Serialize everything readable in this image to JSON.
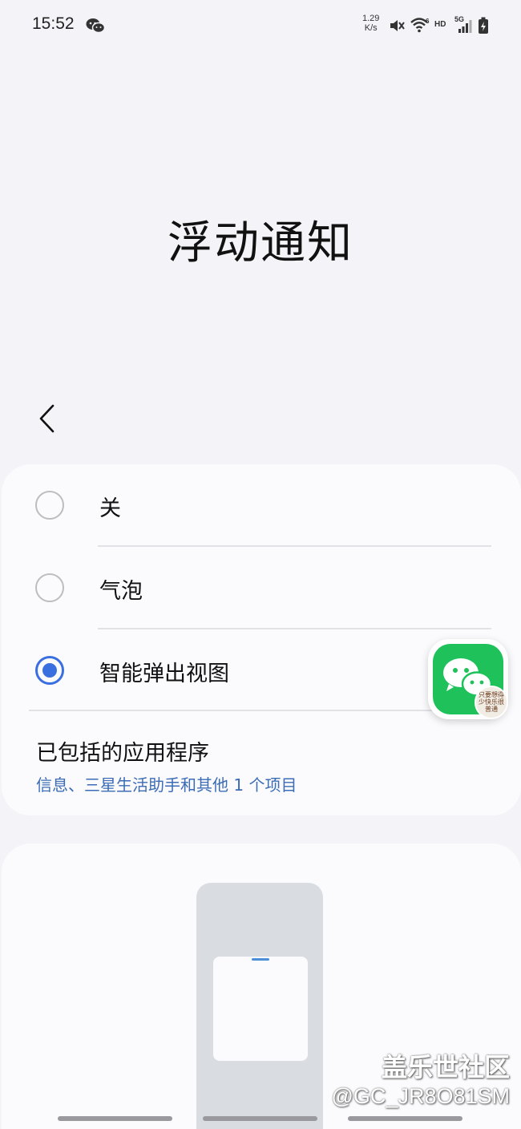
{
  "status_bar": {
    "time": "15:52",
    "net_speed_value": "1.29",
    "net_speed_unit": "K/s",
    "hd_label": "HD",
    "network_label": "5G",
    "icons": [
      "wechat-icon",
      "mute-icon",
      "wifi-icon",
      "signal-icon",
      "battery-charging-icon"
    ]
  },
  "page": {
    "title": "浮动通知"
  },
  "options": [
    {
      "label": "关",
      "selected": false
    },
    {
      "label": "气泡",
      "selected": false
    },
    {
      "label": "智能弹出视图",
      "selected": true
    }
  ],
  "included_apps": {
    "title": "已包括的应用程序",
    "summary": "信息、三星生活助手和其他 1 个项目"
  },
  "floating_bubble": {
    "app_icon": "wechat-icon",
    "avatar_text": "只要想得少快乐很普通"
  },
  "watermark": {
    "site": "盖乐世社区",
    "user": "@GC_JR8O81SM"
  },
  "colors": {
    "accent": "#3a6fe0",
    "link": "#3b6cb5",
    "wechat_green": "#1fc25a",
    "background": "#f4f4f8",
    "card": "#fbfbfd"
  }
}
